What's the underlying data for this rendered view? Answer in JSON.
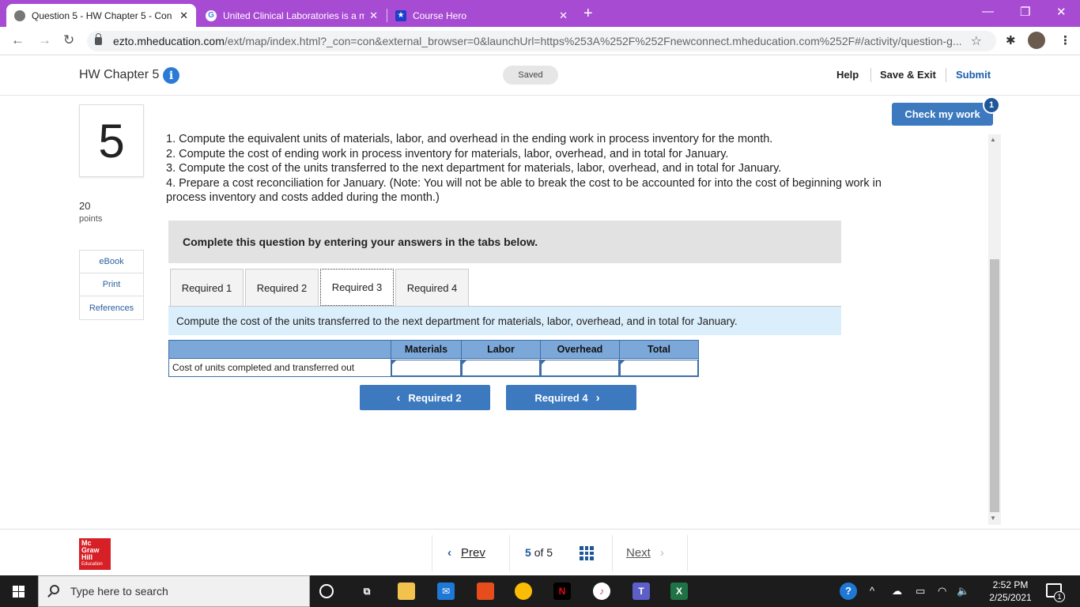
{
  "browser": {
    "tabs": [
      {
        "label": "Question 5 - HW Chapter 5 - Con",
        "active": true
      },
      {
        "label": "United Clinical Laboratories is a m",
        "active": false
      },
      {
        "label": "Course Hero",
        "active": false
      }
    ],
    "url_host": "ezto.mheducation.com",
    "url_path": "/ext/map/index.html?_con=con&external_browser=0&launchUrl=https%253A%252F%252Fnewconnect.mheducation.com%252F#/activity/question-g...",
    "accent_color": "#a84bd3"
  },
  "header": {
    "title": "HW Chapter 5",
    "info_glyph": "i",
    "status": "Saved",
    "help": "Help",
    "save_exit": "Save & Exit",
    "submit": "Submit"
  },
  "question": {
    "number": "5",
    "points_value": "20",
    "points_label": "points",
    "side_links": [
      "eBook",
      "Print",
      "References"
    ],
    "check_label": "Check my work",
    "check_count": "1",
    "instructions": [
      "1. Compute the equivalent units of materials, labor, and overhead in the ending work in process inventory for the month.",
      "2. Compute the cost of ending work in process inventory for materials, labor, overhead, and in total for January.",
      "3. Compute the cost of the units transferred to the next department for materials, labor, overhead, and in total for January.",
      "4. Prepare a cost reconciliation for January. (Note: You will not be able to break the cost to be accounted for into the cost of beginning work in process inventory and costs added during the month.)"
    ],
    "banner": "Complete this question by entering your answers in the tabs below.",
    "tabs": [
      "Required 1",
      "Required 2",
      "Required 3",
      "Required 4"
    ],
    "active_tab": "Required 3",
    "tab_instruction": "Compute the cost of the units transferred to the next department for materials, labor, overhead, and in total for January.",
    "table": {
      "columns": [
        "",
        "Materials",
        "Labor",
        "Overhead",
        "Total"
      ],
      "row_label": "Cost of units completed and transferred out",
      "values": [
        "",
        "",
        "",
        ""
      ]
    },
    "prev_req": "Required 2",
    "next_req": "Required 4"
  },
  "footer": {
    "logo_lines": [
      "Mc",
      "Graw",
      "Hill",
      "Education"
    ],
    "prev": "Prev",
    "current": "5",
    "of": "of",
    "total": "5",
    "next": "Next"
  },
  "taskbar": {
    "search_placeholder": "Type here to search",
    "time": "2:52 PM",
    "date": "2/25/2021",
    "notif_count": "1"
  }
}
